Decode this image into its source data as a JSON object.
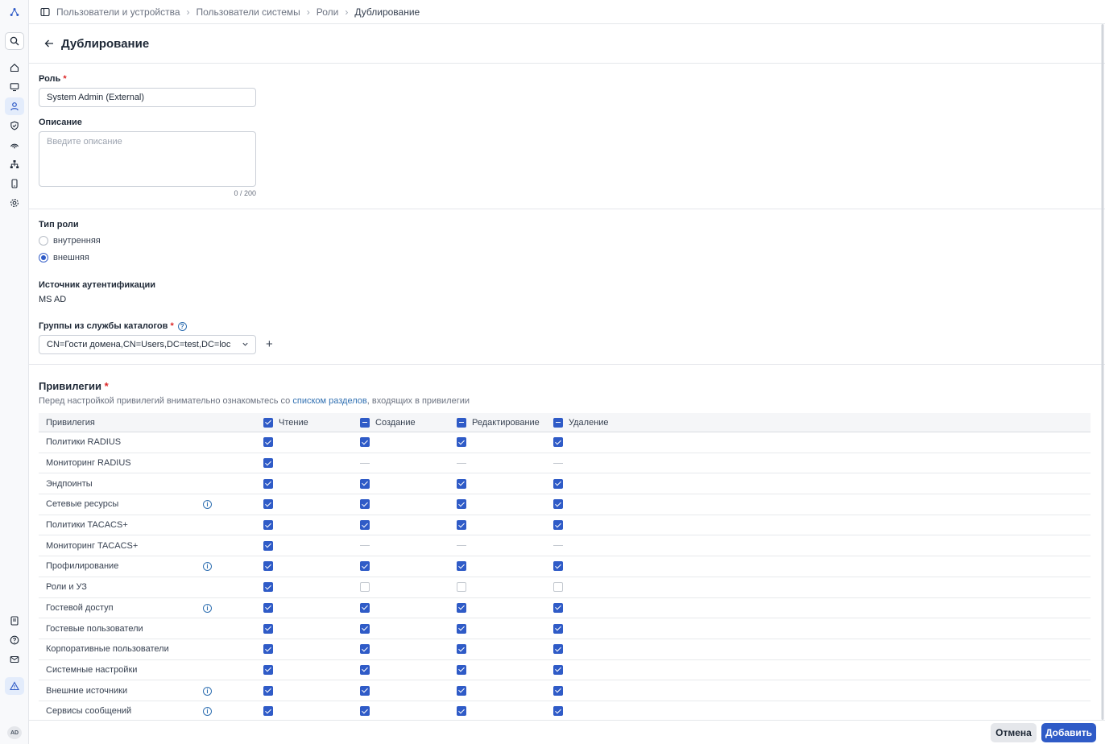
{
  "breadcrumb": [
    "Пользователи и устройства",
    "Пользователи системы",
    "Роли",
    "Дублирование"
  ],
  "page_title": "Дублирование",
  "role_field": {
    "label": "Роль",
    "value": "System Admin (External)"
  },
  "description_field": {
    "label": "Описание",
    "placeholder": "Введите описание",
    "counter": "0 / 200"
  },
  "role_type": {
    "label": "Тип роли",
    "options": [
      "внутренняя",
      "внешняя"
    ],
    "selected": "внешняя"
  },
  "auth_source": {
    "label": "Источник аутентификации",
    "value": "MS AD"
  },
  "groups": {
    "label": "Группы из службы каталогов",
    "value": "CN=Гости домена,CN=Users,DC=test,DC=loc"
  },
  "privileges": {
    "title": "Привилегии",
    "desc_before": "Перед настройкой привилегий внимательно ознакомьтесь со ",
    "desc_link": "списком разделов",
    "desc_after": ", входящих в привилегии",
    "columns": [
      "Привилегия",
      "Чтение",
      "Создание",
      "Редактирование",
      "Удаление"
    ],
    "header_states": [
      "on",
      "part",
      "part",
      "part"
    ],
    "rows": [
      {
        "name": "Политики RADIUS",
        "info": false,
        "states": [
          "on",
          "on",
          "on",
          "on"
        ]
      },
      {
        "name": "Мониторинг RADIUS",
        "info": false,
        "states": [
          "on",
          "none",
          "none",
          "none"
        ]
      },
      {
        "name": "Эндпоинты",
        "info": false,
        "states": [
          "on",
          "on",
          "on",
          "on"
        ]
      },
      {
        "name": "Сетевые ресурсы",
        "info": true,
        "states": [
          "on",
          "on",
          "on",
          "on"
        ]
      },
      {
        "name": "Политики TACACS+",
        "info": false,
        "states": [
          "on",
          "on",
          "on",
          "on"
        ]
      },
      {
        "name": "Мониторинг TACACS+",
        "info": false,
        "states": [
          "on",
          "none",
          "none",
          "none"
        ]
      },
      {
        "name": "Профилирование",
        "info": true,
        "states": [
          "on",
          "on",
          "on",
          "on"
        ]
      },
      {
        "name": "Роли и УЗ",
        "info": false,
        "states": [
          "on",
          "off",
          "off",
          "off"
        ]
      },
      {
        "name": "Гостевой доступ",
        "info": true,
        "states": [
          "on",
          "on",
          "on",
          "on"
        ]
      },
      {
        "name": "Гостевые пользователи",
        "info": false,
        "states": [
          "on",
          "on",
          "on",
          "on"
        ]
      },
      {
        "name": "Корпоративные пользователи",
        "info": false,
        "states": [
          "on",
          "on",
          "on",
          "on"
        ]
      },
      {
        "name": "Системные настройки",
        "info": false,
        "states": [
          "on",
          "on",
          "on",
          "on"
        ]
      },
      {
        "name": "Внешние источники",
        "info": true,
        "states": [
          "on",
          "on",
          "on",
          "on"
        ]
      },
      {
        "name": "Сервисы сообщений",
        "info": true,
        "states": [
          "on",
          "on",
          "on",
          "on"
        ]
      }
    ]
  },
  "footer": {
    "cancel": "Отмена",
    "add": "Добавить"
  },
  "user_initials": "AD",
  "colors": {
    "accent": "#2f5bc7",
    "link": "#2f6fb1",
    "required": "#dc2626"
  }
}
